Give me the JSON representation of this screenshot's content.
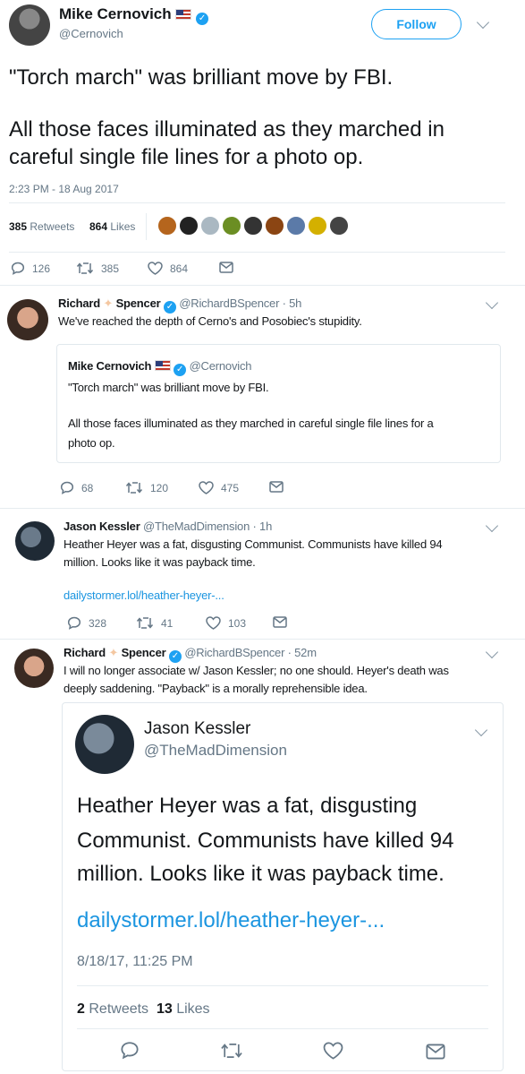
{
  "main_tweet": {
    "name": "Mike Cernovich",
    "handle": "@Cernovich",
    "follow_label": "Follow",
    "text_line1": "\"Torch march\" was brilliant move by FBI.",
    "text_line2": "All those faces illuminated as they marched in",
    "text_line3": "careful single file lines for a photo op.",
    "timestamp": "2:23 PM - 18 Aug 2017",
    "retweets_count": "385",
    "retweets_label": "Retweets",
    "likes_count": "864",
    "likes_label": "Likes",
    "reply_count": "126",
    "retweet_count": "385",
    "like_count": "864"
  },
  "reply1": {
    "name_first": "Richard",
    "name_last": "Spencer",
    "handle_time": "@RichardBSpencer · 5h",
    "text": "We've reached the depth of Cerno's and Posobiec's stupidity.",
    "quote": {
      "name": "Mike Cernovich",
      "handle": "@Cernovich",
      "line1": "\"Torch march\" was brilliant move by FBI.",
      "line2": "All those faces illuminated as they marched in careful single file lines for a",
      "line3": "photo op."
    },
    "reply_count": "68",
    "retweet_count": "120",
    "like_count": "475"
  },
  "reply2": {
    "name": "Jason Kessler",
    "handle_time": "@TheMadDimension · 1h",
    "line1": "Heather Heyer was a fat, disgusting Communist. Communists have killed 94",
    "line2": "million. Looks like it was payback time.",
    "link": "dailystormer.lol/heather-heyer-...",
    "reply_count": "328",
    "retweet_count": "41",
    "like_count": "103"
  },
  "reply3": {
    "name_first": "Richard",
    "name_last": "Spencer",
    "handle_time": "@RichardBSpencer · 52m",
    "line1": "I will no longer associate w/ Jason Kessler; no one should. Heyer's death was",
    "line2": "deeply saddening. \"Payback\" is a morally reprehensible idea.",
    "embedded": {
      "name": "Jason Kessler",
      "handle": "@TheMadDimension",
      "line1": "Heather Heyer was a fat, disgusting",
      "line2": "Communist. Communists have killed 94",
      "line3": "million. Looks like it was payback time.",
      "link": "dailystormer.lol/heather-heyer-...",
      "timestamp": "8/18/17, 11:25 PM",
      "retweets_count": "2",
      "retweets_label": "Retweets",
      "likes_count": "13",
      "likes_label": "Likes"
    }
  },
  "colors": {
    "accent": "#1da1f2",
    "link": "#1b95e0",
    "secondary": "#657786"
  },
  "icons": [
    "reply-icon",
    "retweet-icon",
    "like-icon",
    "message-icon",
    "verified-icon",
    "chevron-down-icon",
    "us-flag-icon"
  ]
}
